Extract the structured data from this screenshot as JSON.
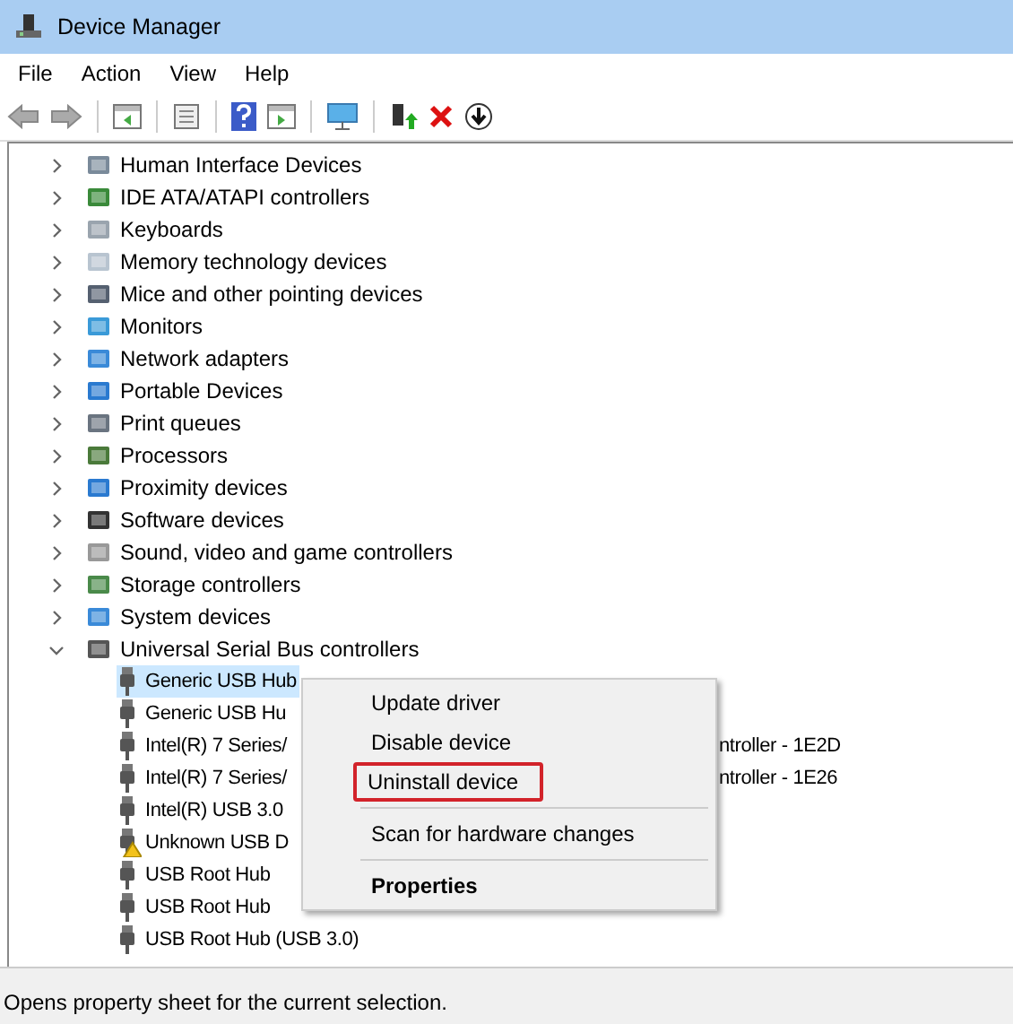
{
  "window": {
    "title": "Device Manager"
  },
  "menu": [
    "File",
    "Action",
    "View",
    "Help"
  ],
  "tree": [
    {
      "label": "Human Interface Devices",
      "expanded": false
    },
    {
      "label": "IDE ATA/ATAPI controllers",
      "expanded": false
    },
    {
      "label": "Keyboards",
      "expanded": false
    },
    {
      "label": "Memory technology devices",
      "expanded": false
    },
    {
      "label": "Mice and other pointing devices",
      "expanded": false
    },
    {
      "label": "Monitors",
      "expanded": false
    },
    {
      "label": "Network adapters",
      "expanded": false
    },
    {
      "label": "Portable Devices",
      "expanded": false
    },
    {
      "label": "Print queues",
      "expanded": false
    },
    {
      "label": "Processors",
      "expanded": false
    },
    {
      "label": "Proximity devices",
      "expanded": false
    },
    {
      "label": "Software devices",
      "expanded": false
    },
    {
      "label": "Sound, video and game controllers",
      "expanded": false
    },
    {
      "label": "Storage controllers",
      "expanded": false
    },
    {
      "label": "System devices",
      "expanded": false
    },
    {
      "label": "Universal Serial Bus controllers",
      "expanded": true,
      "children": [
        {
          "label": "Generic USB Hub",
          "selected": true,
          "warning": false
        },
        {
          "label": "Generic USB Hu",
          "selected": false,
          "warning": false
        },
        {
          "label": "Intel(R) 7 Series/",
          "tail": "ntroller - 1E2D",
          "selected": false,
          "warning": false
        },
        {
          "label": "Intel(R) 7 Series/",
          "tail": "ntroller - 1E26",
          "selected": false,
          "warning": false
        },
        {
          "label": "Intel(R) USB 3.0",
          "selected": false,
          "warning": false
        },
        {
          "label": "Unknown USB D",
          "selected": false,
          "warning": true
        },
        {
          "label": "USB Root Hub",
          "selected": false,
          "warning": false
        },
        {
          "label": "USB Root Hub",
          "selected": false,
          "warning": false
        },
        {
          "label": "USB Root Hub (USB 3.0)",
          "selected": false,
          "warning": false
        }
      ]
    }
  ],
  "context_menu": [
    {
      "kind": "item",
      "label": "Update driver",
      "highlighted": false,
      "default": false
    },
    {
      "kind": "item",
      "label": "Disable device",
      "highlighted": false,
      "default": false
    },
    {
      "kind": "item",
      "label": "Uninstall device",
      "highlighted": true,
      "default": false
    },
    {
      "kind": "separator"
    },
    {
      "kind": "item",
      "label": "Scan for hardware changes",
      "highlighted": false,
      "default": false
    },
    {
      "kind": "separator"
    },
    {
      "kind": "item",
      "label": "Properties",
      "highlighted": false,
      "default": true
    }
  ],
  "status_bar": "Opens property sheet for the current selection."
}
